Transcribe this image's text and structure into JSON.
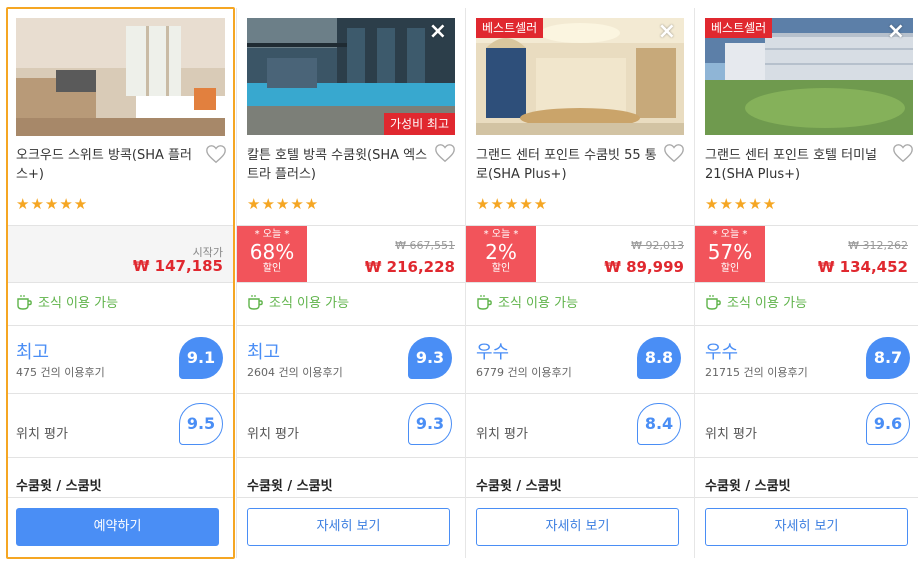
{
  "hotels": [
    {
      "name": "오크우드 스위트 방콕(SHA 플러스+)",
      "stars": "★★★★★",
      "start_label": "시작가",
      "price": "₩ 147,185",
      "breakfast": "조식 이용 가능",
      "rating_word": "최고",
      "review_count": "475 건의 이용후기",
      "score": "9.1",
      "location_label": "위치 평가",
      "location_score": "9.5",
      "room_type": "수쿰윗 / 스쿰빗",
      "button_label": "예약하기"
    },
    {
      "name": "칼튼 호텔 방콕 수쿰윗(SHA 엑스트라 플러스)",
      "stars": "★★★★★",
      "tag_value": "가성비 최고",
      "discount_today": "* 오늘 *",
      "discount_pct": "68%",
      "discount_sub": "할인",
      "old_price": "₩ 667,551",
      "price": "₩ 216,228",
      "breakfast": "조식 이용 가능",
      "rating_word": "최고",
      "review_count": "2604 건의 이용후기",
      "score": "9.3",
      "location_label": "위치 평가",
      "location_score": "9.3",
      "room_type": "수쿰윗 / 스쿰빗",
      "button_label": "자세히 보기"
    },
    {
      "name": "그랜드 센터 포인트 수쿰빗 55 통로(SHA Plus+)",
      "stars": "★★★★★",
      "tag_best": "베스트셀러",
      "discount_today": "* 오늘 *",
      "discount_pct": "2%",
      "discount_sub": "할인",
      "old_price": "₩ 92,013",
      "price": "₩ 89,999",
      "breakfast": "조식 이용 가능",
      "rating_word": "우수",
      "review_count": "6779 건의 이용후기",
      "score": "8.8",
      "location_label": "위치 평가",
      "location_score": "8.4",
      "room_type": "수쿰윗 / 스쿰빗",
      "button_label": "자세히 보기"
    },
    {
      "name": "그랜드 센터 포인트 호텔 터미널 21(SHA Plus+)",
      "stars": "★★★★★",
      "tag_best": "베스트셀러",
      "discount_today": "* 오늘 *",
      "discount_pct": "57%",
      "discount_sub": "할인",
      "old_price": "₩ 312,262",
      "price": "₩ 134,452",
      "breakfast": "조식 이용 가능",
      "rating_word": "우수",
      "review_count": "21715 건의 이용후기",
      "score": "8.7",
      "location_label": "위치 평가",
      "location_score": "9.6",
      "room_type": "수쿰윗 / 스쿰빗",
      "button_label": "자세히 보기"
    }
  ],
  "close_icon": "×",
  "colors": {
    "accent_blue": "#4a8ef5",
    "price_red": "#e0282f",
    "discount_red": "#f2545b",
    "star_orange": "#f5a623",
    "breakfast_green": "#5fb34a",
    "selected_border": "#f5a623"
  },
  "icons": {
    "close": "close-icon",
    "heart": "heart-icon",
    "breakfast": "coffee-cup-icon",
    "star": "star-icon"
  }
}
